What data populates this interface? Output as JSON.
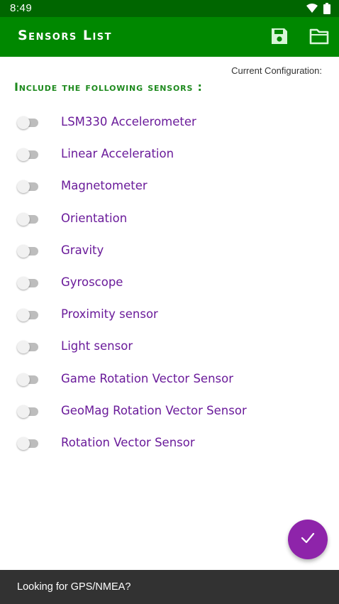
{
  "status_bar": {
    "time": "8:49",
    "icons": [
      "wifi-icon",
      "battery-icon"
    ]
  },
  "app_bar": {
    "title": "Sensors List",
    "actions": [
      "save-icon",
      "folder-icon"
    ],
    "background": "#008800"
  },
  "config": {
    "current_label": "Current Configuration:"
  },
  "section": {
    "heading": "Include the following sensors :"
  },
  "sensors": [
    {
      "label": "LSM330 Accelerometer",
      "enabled": false
    },
    {
      "label": "Linear Acceleration",
      "enabled": false
    },
    {
      "label": "Magnetometer",
      "enabled": false
    },
    {
      "label": "Orientation",
      "enabled": false
    },
    {
      "label": "Gravity",
      "enabled": false
    },
    {
      "label": "Gyroscope",
      "enabled": false
    },
    {
      "label": "Proximity sensor",
      "enabled": false
    },
    {
      "label": "Light sensor",
      "enabled": false
    },
    {
      "label": "Game Rotation Vector Sensor",
      "enabled": false
    },
    {
      "label": "GeoMag Rotation Vector Sensor",
      "enabled": false
    },
    {
      "label": "Rotation Vector Sensor",
      "enabled": false
    }
  ],
  "fab": {
    "icon": "check-icon",
    "color": "#8e24aa"
  },
  "snackbar": {
    "text": "Looking for GPS/NMEA?"
  },
  "colors": {
    "sensor_text": "#6a1b9a",
    "heading": "#1e8a1e"
  }
}
